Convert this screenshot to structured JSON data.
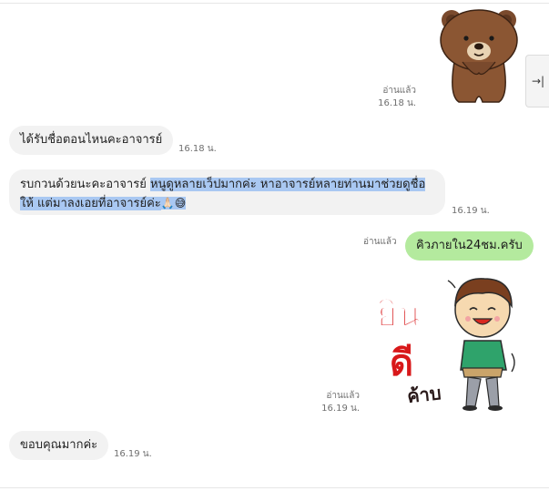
{
  "side_panel": {
    "toggle_icon": "→|"
  },
  "messages": [
    {
      "type": "sticker",
      "sender": "self",
      "name": "brown-bear-bow",
      "read_label": "อ่านแล้ว",
      "time": "16.18 น."
    },
    {
      "type": "text",
      "sender": "other",
      "text": "ได้รับชื่อตอนไหนคะอาจารย์",
      "time": "16.18 น."
    },
    {
      "type": "text",
      "sender": "other",
      "text_plain_1": "รบกวนด้วยนะคะอาจารย์ ",
      "text_highlight_1": "หนูดูหลายเว็ปมากค่ะ หาอาจารย์หลายท่านมาช่วยดูชื่อ",
      "text_highlight_2": "ให้ แต่มาลงเอยที่อาจารย์ค่ะ",
      "emoji": "🙏🏻😅",
      "time": "16.19 น."
    },
    {
      "type": "text",
      "sender": "self",
      "text": "คิวภายใน24ชม.ครับ",
      "read_label": "อ่านแล้ว"
    },
    {
      "type": "sticker",
      "sender": "self",
      "name": "boy-welcome",
      "sticker_text_1": "ยิน",
      "sticker_text_2": "ดี",
      "sticker_text_3": "ค้าบ",
      "read_label": "อ่านแล้ว",
      "time": "16.19 น."
    },
    {
      "type": "text",
      "sender": "other",
      "text": "ขอบคุณมากค่ะ",
      "time": "16.19 น."
    }
  ],
  "colors": {
    "sent_bubble": "#b4ea9e",
    "received_bubble": "#f2f2f2",
    "highlight": "#a9c8f2"
  }
}
